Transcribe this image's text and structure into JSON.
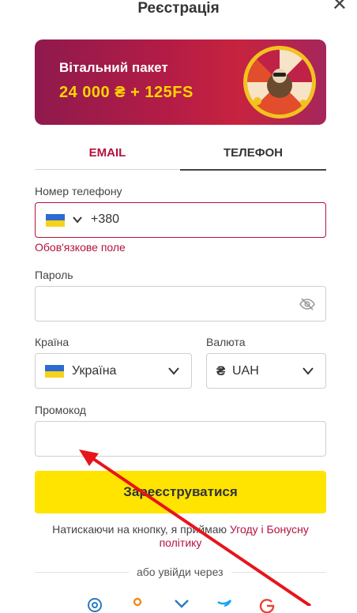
{
  "header": {
    "title": "Реєстрація",
    "close_glyph": "✕"
  },
  "banner": {
    "line1": "Вітальний пакет",
    "line2": "24 000 ₴ + 125FS"
  },
  "tabs": [
    {
      "label": "EMAIL"
    },
    {
      "label": "ТЕЛЕФОН"
    }
  ],
  "phone": {
    "label": "Номер телефону",
    "code": "+380",
    "error": "Обов'язкове поле"
  },
  "password": {
    "label": "Пароль"
  },
  "country": {
    "label": "Країна",
    "value": "Україна"
  },
  "currency": {
    "label": "Валюта",
    "symbol": "₴",
    "value": "UAH"
  },
  "promo": {
    "label": "Промокод"
  },
  "submit": {
    "label": "Зареєструватися"
  },
  "terms": {
    "text": "Натискаючи на кнопку, я приймаю ",
    "link": "Угоду і Бонусну політику"
  },
  "divider_text": "або увійди через",
  "colors": {
    "accent": "#b4123e",
    "submit_bg": "#ffe400",
    "annotation_arrow": "#e8141c"
  },
  "icons": [
    "close-icon",
    "eye-off-icon",
    "chevron-down-icon",
    "flag-ua-icon",
    "hryvnia-icon",
    "instagram-icon",
    "odnoklassniki-icon",
    "vk-icon",
    "twitter-icon",
    "google-icon"
  ]
}
